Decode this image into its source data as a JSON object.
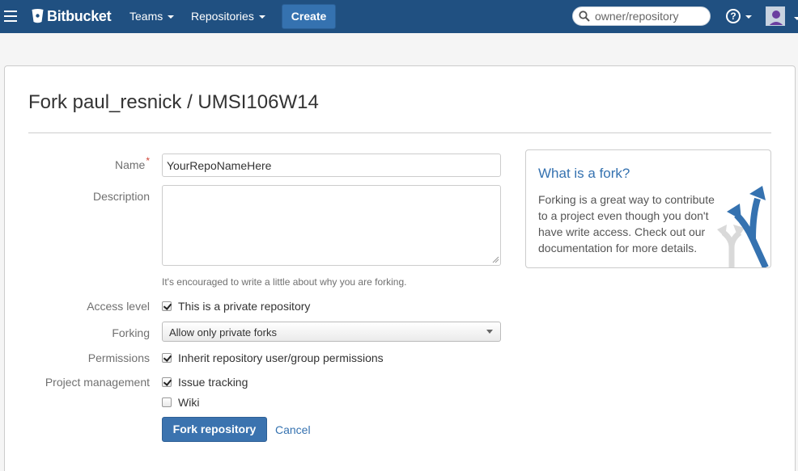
{
  "header": {
    "logo_text": "Bitbucket",
    "nav": [
      {
        "label": "Teams"
      },
      {
        "label": "Repositories"
      }
    ],
    "create_label": "Create",
    "search_placeholder": "owner/repository",
    "help_symbol": "?",
    "bar_color": "#205081"
  },
  "page": {
    "title": "Fork paul_resnick / UMSI106W14"
  },
  "form": {
    "name_label": "Name",
    "name_required_mark": "*",
    "name_value": "YourRepoNameHere",
    "description_label": "Description",
    "description_value": "",
    "description_hint": "It's encouraged to write a little about why you are forking.",
    "access_label": "Access level",
    "access_checkbox_label": "This is a private repository",
    "access_checked": true,
    "forking_label": "Forking",
    "forking_selected": "Allow only private forks",
    "permissions_label": "Permissions",
    "permissions_checkbox_label": "Inherit repository user/group permissions",
    "permissions_checked": true,
    "project_label": "Project management",
    "issue_tracking_label": "Issue tracking",
    "issue_tracking_checked": true,
    "wiki_label": "Wiki",
    "wiki_checked": false,
    "submit_label": "Fork repository",
    "cancel_label": "Cancel"
  },
  "info": {
    "title": "What is a fork?",
    "body": "Forking is a great way to contribute to a project even though you don't have write access. Check out our documentation for more details.",
    "graphic_icon": "fork-arrows-icon"
  },
  "colors": {
    "accent": "#3572b0",
    "required": "#d04437"
  }
}
